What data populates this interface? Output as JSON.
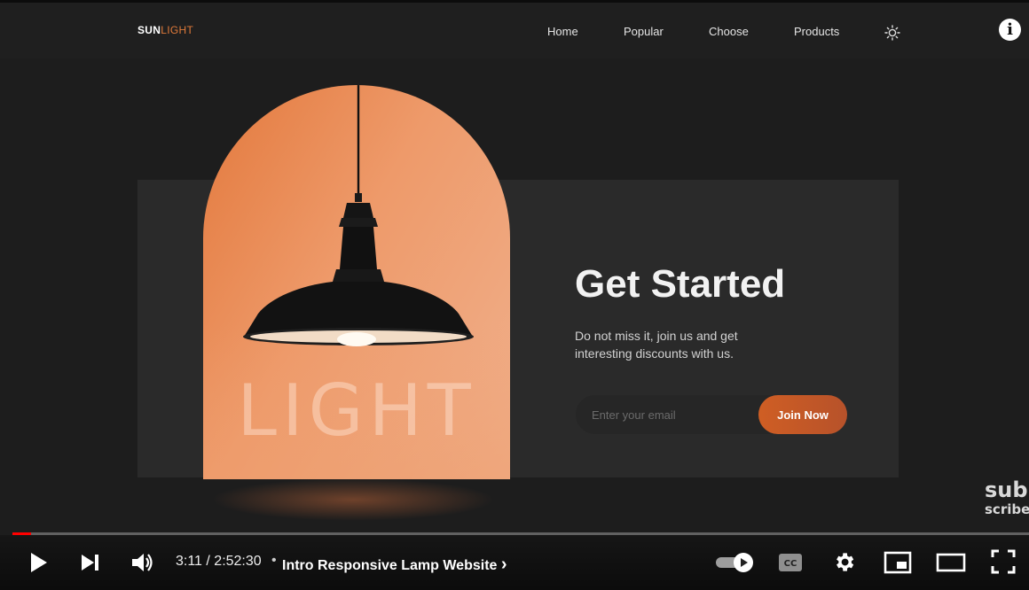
{
  "site": {
    "logo_bold": "SUN",
    "logo_light": "LIGHT",
    "nav": [
      "Home",
      "Popular",
      "Choose",
      "Products"
    ],
    "theme_icon": "sun-icon",
    "info_icon": "info-icon",
    "info_glyph": "i"
  },
  "hero": {
    "watermark_text": "LIGHT",
    "title": "Get Started",
    "subtitle": "Do not miss it, join us and get interesting discounts with us.",
    "email_placeholder": "Enter your email",
    "email_value": "",
    "button_label": "Join Now"
  },
  "overlay": {
    "subscribe_line1": "sub",
    "subscribe_line2": "scribe"
  },
  "player": {
    "progress": 0.018,
    "time": "3:11 / 2:52:30",
    "separator": "•",
    "chapter": "Intro Responsive Lamp Website",
    "chapter_arrow": "›",
    "autoplay_on": true,
    "icons": {
      "play": "play-icon",
      "next": "next-icon",
      "volume": "volume-icon",
      "autoplay": "autoplay-toggle-icon",
      "captions": "cc-icon",
      "settings": "gear-icon",
      "miniplayer": "miniplayer-icon",
      "theater": "theater-icon",
      "fullscreen": "fullscreen-icon"
    }
  },
  "colors": {
    "accent": "#d0652f",
    "background": "#1d1d1d",
    "panel": "#2a2a2a",
    "progress": "#ff0000"
  }
}
